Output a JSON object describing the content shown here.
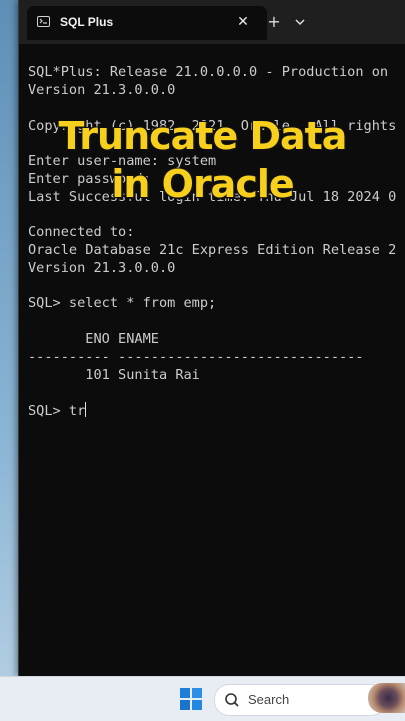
{
  "window": {
    "tab_title": "SQL Plus",
    "close_symbol": "✕",
    "new_tab_symbol": "+"
  },
  "terminal": {
    "lines": [
      "SQL*Plus: Release 21.0.0.0.0 - Production on",
      "Version 21.3.0.0.0",
      "",
      "Copyright (c) 1982, 2021, Oracle.  All rights",
      "",
      "Enter user-name: system",
      "Enter password:",
      "Last Successful login time: Thu Jul 18 2024 0",
      "",
      "Connected to:",
      "Oracle Database 21c Express Edition Release 2",
      "Version 21.3.0.0.0",
      "",
      "SQL> select * from emp;",
      "",
      "       ENO ENAME",
      "---------- ------------------------------",
      "       101 Sunita Rai",
      "",
      "SQL> tr"
    ]
  },
  "overlay": {
    "line1": "Truncate Data",
    "line2": "in Oracle"
  },
  "taskbar": {
    "search_label": "Search"
  },
  "colors": {
    "overlay_text": "#f7cf1d",
    "terminal_bg": "#0c0c0c",
    "terminal_text": "#cccccc"
  }
}
